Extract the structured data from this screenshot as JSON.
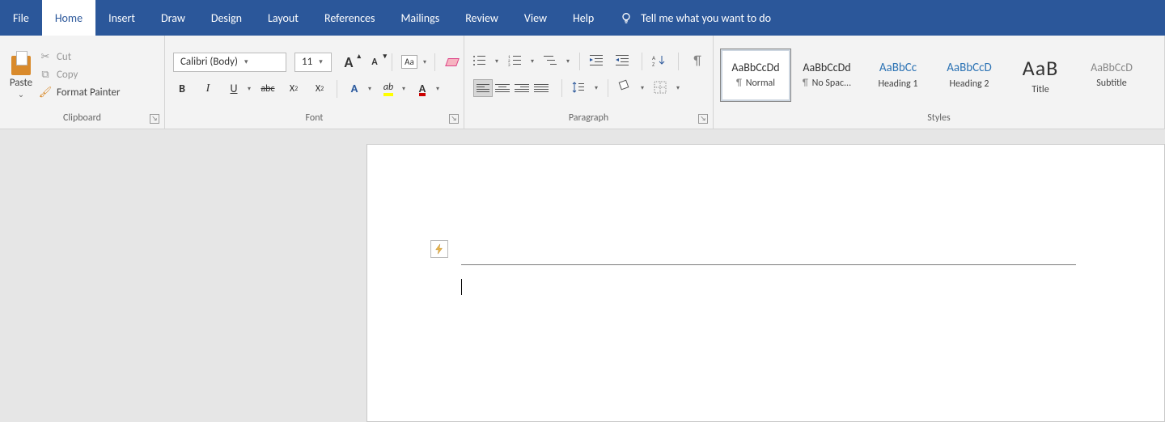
{
  "tabs": {
    "file": "File",
    "home": "Home",
    "insert": "Insert",
    "draw": "Draw",
    "design": "Design",
    "layout": "Layout",
    "references": "References",
    "mailings": "Mailings",
    "review": "Review",
    "view": "View",
    "help": "Help",
    "tellme": "Tell me what you want to do"
  },
  "clipboard": {
    "paste": "Paste",
    "cut": "Cut",
    "copy": "Copy",
    "format_painter": "Format Painter",
    "label": "Clipboard"
  },
  "font": {
    "name": "Calibri (Body)",
    "size": "11",
    "label": "Font"
  },
  "paragraph": {
    "label": "Paragraph"
  },
  "styles": {
    "label": "Styles",
    "items": [
      {
        "preview": "AaBbCcDd",
        "name": "Normal",
        "pil": true,
        "cls": "",
        "selected": true
      },
      {
        "preview": "AaBbCcDd",
        "name": "No Spac...",
        "pil": true,
        "cls": "",
        "selected": false
      },
      {
        "preview": "AaBbCc",
        "name": "Heading 1",
        "pil": false,
        "cls": "heading",
        "selected": false
      },
      {
        "preview": "AaBbCcD",
        "name": "Heading 2",
        "pil": false,
        "cls": "heading",
        "selected": false
      },
      {
        "preview": "AaB",
        "name": "Title",
        "pil": false,
        "cls": "title",
        "selected": false
      },
      {
        "preview": "AaBbCcD",
        "name": "Subtitle",
        "pil": false,
        "cls": "sub",
        "selected": false
      }
    ]
  }
}
